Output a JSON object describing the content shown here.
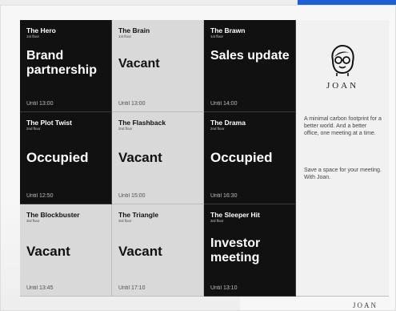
{
  "tiles": [
    {
      "room": "The Hero",
      "floor": "1st floor",
      "status": "Brand partnership",
      "until": "Until 13:00",
      "theme": "dark"
    },
    {
      "room": "The Brain",
      "floor": "1st floor",
      "status": "Vacant",
      "until": "Until 13:00",
      "theme": "light"
    },
    {
      "room": "The Brawn",
      "floor": "1st floor",
      "status": "Sales update",
      "until": "Until 14:00",
      "theme": "dark"
    },
    {
      "room": "The Plot Twist",
      "floor": "2nd floor",
      "status": "Occupied",
      "until": "Until 12:50",
      "theme": "dark"
    },
    {
      "room": "The Flashback",
      "floor": "2nd floor",
      "status": "Vacant",
      "until": "Until 15:00",
      "theme": "light"
    },
    {
      "room": "The Drama",
      "floor": "2nd floor",
      "status": "Occupied",
      "until": "Until 16:30",
      "theme": "dark"
    },
    {
      "room": "The Blockbuster",
      "floor": "3rd floor",
      "status": "Vacant",
      "until": "Until 13:45",
      "theme": "light"
    },
    {
      "room": "The Triangle",
      "floor": "3rd floor",
      "status": "Vacant",
      "until": "Until 17:10",
      "theme": "light"
    },
    {
      "room": "The Sleeper Hit",
      "floor": "3rd floor",
      "status": "Investor meeting",
      "until": "Until 13:10",
      "theme": "dark"
    }
  ],
  "info": {
    "brand": "JOAN",
    "text1": "A minimal carbon footprint for a better world. And a better office, one meeting at a time.",
    "text2": "Save a space for your meeting. With Joan."
  },
  "footer": {
    "brand": "JOAN"
  },
  "colors": {
    "dark_tile": "#111111",
    "light_tile": "#d9d9d9",
    "accent": "#1f5fd6"
  },
  "icons": {
    "logo": "joan-face-icon"
  }
}
